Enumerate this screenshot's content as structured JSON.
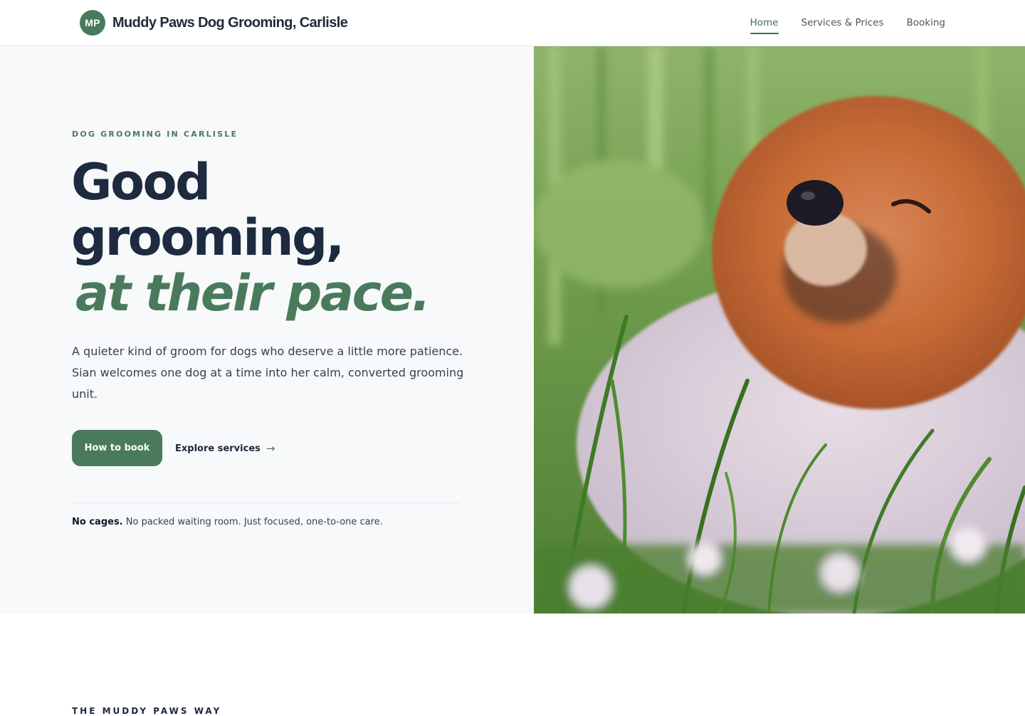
{
  "header": {
    "logo_initials": "MP",
    "brand_name": "Muddy Paws Dog Grooming, Carlisle",
    "nav": [
      {
        "label": "Home",
        "active": true
      },
      {
        "label": "Services & Prices",
        "active": false
      },
      {
        "label": "Booking",
        "active": false
      }
    ]
  },
  "hero": {
    "eyebrow": "DOG GROOMING IN CARLISLE",
    "headline_line1": "Good",
    "headline_line2": "grooming,",
    "headline_accent": "at their pace.",
    "lead": "A quieter kind of groom for dogs who deserve a little more patience. Sian welcomes one dog at a time into her calm, converted grooming unit.",
    "primary_button": "How to book",
    "secondary_link": "Explore services",
    "secondary_link_icon": "arrow-right-icon",
    "note_bold": "No cages.",
    "note_rest": " No packed waiting room. Just focused, one-to-one care.",
    "image_subject": "pomeranian-dog-in-grass"
  },
  "next_section": {
    "eyebrow": "THE MUDDY PAWS WAY"
  },
  "colors": {
    "accent": "#4a7a5c",
    "heading": "#1d2a3f",
    "hero_bg": "#f7f9fb"
  }
}
